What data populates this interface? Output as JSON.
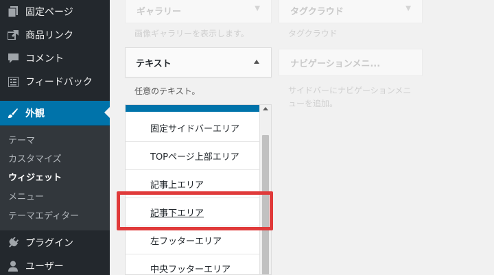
{
  "sidebar": {
    "items": [
      {
        "label": "固定ページ",
        "icon": "pages-icon"
      },
      {
        "label": "商品リンク",
        "icon": "link-icon"
      },
      {
        "label": "コメント",
        "icon": "comment-icon"
      },
      {
        "label": "フィードバック",
        "icon": "feedback-icon"
      },
      {
        "label": "外観",
        "icon": "brush-icon",
        "active": true
      },
      {
        "label": "プラグイン",
        "icon": "plugin-icon"
      },
      {
        "label": "ユーザー",
        "icon": "user-icon"
      }
    ],
    "submenu": [
      {
        "label": "テーマ"
      },
      {
        "label": "カスタマイズ"
      },
      {
        "label": "ウィジェット",
        "current": true
      },
      {
        "label": "メニュー"
      },
      {
        "label": "テーマエディター"
      }
    ],
    "colors": {
      "background": "#23282d",
      "submenu": "#32373c",
      "active": "#0073aa"
    }
  },
  "widgets": {
    "gallery": {
      "title": "ギャラリー",
      "description": "画像ギャラリーを表示します。"
    },
    "tagcloud": {
      "title": "タグクラウド",
      "description": "タグクラウド"
    },
    "text": {
      "title": "テキスト",
      "description": "任意のテキスト。"
    },
    "navmenu": {
      "title": "ナビゲーションメニ...",
      "description_line1": "サイドバーにナビゲーションメニ",
      "description_line2": "ューを追加。"
    }
  },
  "chooser": {
    "areas": [
      "固定サイドバーエリア",
      "TOPページ上部エリア",
      "記事上エリア",
      "記事下エリア",
      "左フッターエリア",
      "中央フッターエリア"
    ],
    "hovered_area": "記事下エリア"
  },
  "colors": {
    "highlight": "#e03a3a",
    "accent": "#0073aa"
  }
}
